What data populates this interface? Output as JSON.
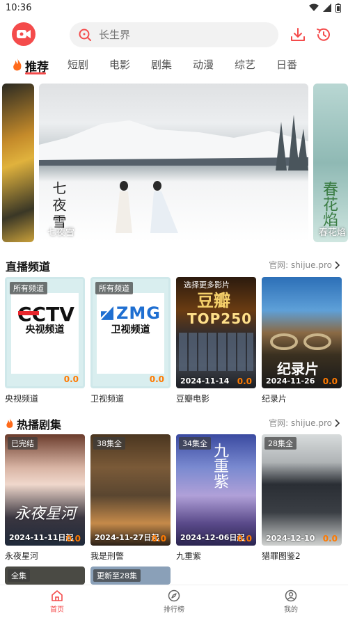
{
  "status": {
    "time": "10:36"
  },
  "search": {
    "placeholder": "长生界"
  },
  "tabs": [
    "推荐",
    "短剧",
    "电影",
    "剧集",
    "动漫",
    "综艺",
    "日番"
  ],
  "banner": {
    "main_caption": "七夜雪",
    "main_title_art": "七夜雪",
    "right_caption": "春花焰",
    "right_title_art": "春花焰"
  },
  "live": {
    "title": "直播频道",
    "link_label": "官网: shijue.pro",
    "cards": [
      {
        "tag": "所有频道",
        "channel": "央视频道",
        "logo": "CCTV",
        "score": "0.0",
        "label": "央视频道"
      },
      {
        "tag": "所有频道",
        "channel": "卫视频道",
        "logo": "ZMG",
        "score": "0.0",
        "label": "卫视频道"
      },
      {
        "tag": "选择更多影片",
        "art": "豆瓣",
        "art2": "TOP250",
        "date": "2024-11-14",
        "score": "0.0",
        "label": "豆瓣电影"
      },
      {
        "art": "纪录片",
        "date": "2024-11-26",
        "score": "0.0",
        "label": "纪录片"
      }
    ]
  },
  "hot": {
    "title": "热播剧集",
    "link_label": "官网: shijue.pro",
    "cards": [
      {
        "tag": "已完结",
        "art": "永夜星河",
        "date": "2024-11-11日起",
        "score": "0.0",
        "label": "永夜星河"
      },
      {
        "tag": "38集全",
        "date": "2024-11-27日起",
        "score": "0.0",
        "label": "我是刑警"
      },
      {
        "tag": "34集全",
        "art": "九重紫",
        "date": "2024-12-06日起",
        "score": "0.0",
        "label": "九重紫"
      },
      {
        "tag": "28集全",
        "date": "2024-12-10",
        "score": "0.0",
        "label": "猎罪图鉴2"
      }
    ],
    "peek": [
      {
        "tag": "全集"
      },
      {
        "tag": "更新至28集"
      }
    ]
  },
  "nav": [
    {
      "label": "首页",
      "icon": "home-icon"
    },
    {
      "label": "排行榜",
      "icon": "compass-icon"
    },
    {
      "label": "我的",
      "icon": "user-icon"
    }
  ],
  "colors": {
    "accent": "#f44b4b",
    "score": "#ff7a00"
  }
}
